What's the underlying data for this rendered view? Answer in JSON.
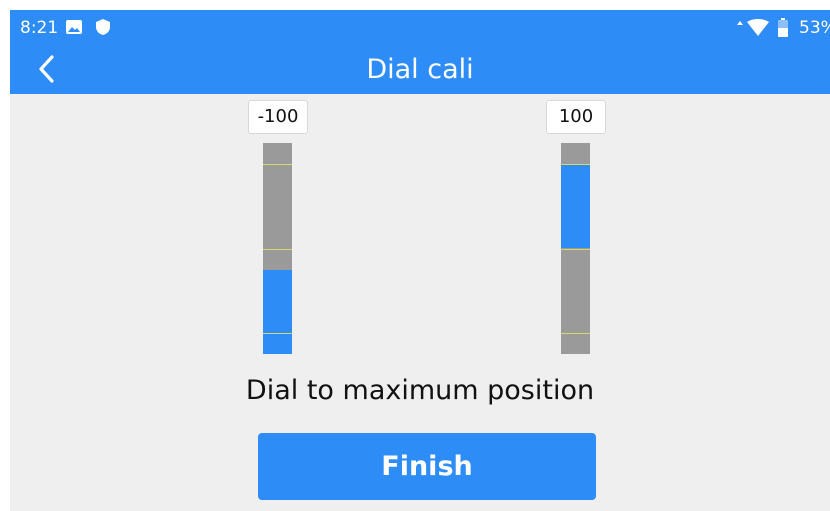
{
  "status_bar": {
    "time": "8:21",
    "battery_text": "53%",
    "icons": [
      "image-icon",
      "shield-icon",
      "data-arrows-icon",
      "wifi-icon",
      "battery-icon"
    ]
  },
  "header": {
    "title": "Dial cali",
    "back_icon": "chevron-left-icon"
  },
  "dials": {
    "left": {
      "value": "-100",
      "fill_range": [
        0.0,
        0.4
      ],
      "marker_levels": [
        0.1,
        0.5,
        0.9
      ]
    },
    "right": {
      "value": "100",
      "fill_range": [
        0.5,
        0.9
      ],
      "marker_levels": [
        0.1,
        0.5,
        0.9
      ]
    }
  },
  "instruction": "Dial to maximum position",
  "finish_button": {
    "label": "Finish"
  },
  "colors": {
    "accent": "#2e8cf7",
    "background": "#efefef",
    "track": "#9a9a9a",
    "marker": "#d8d86a"
  }
}
